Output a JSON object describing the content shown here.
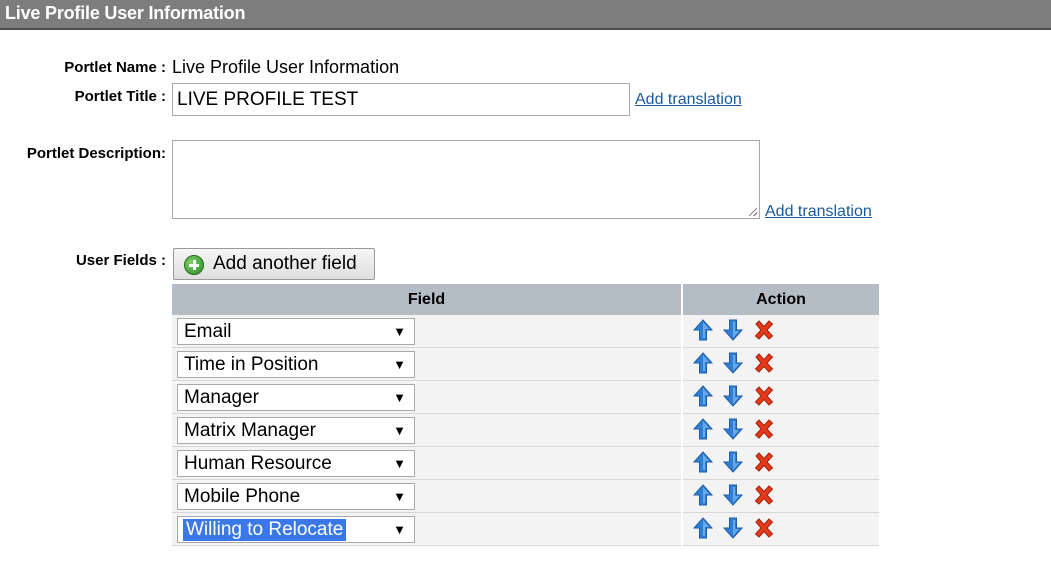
{
  "header": {
    "title": "Live Profile User Information"
  },
  "form": {
    "portlet_name_label": "Portlet Name :",
    "portlet_name_value": "Live Profile User Information",
    "portlet_title_label": "Portlet Title :",
    "portlet_title_value": "LIVE PROFILE TEST",
    "portlet_description_label": "Portlet Description:",
    "portlet_description_value": "",
    "add_translation": "Add translation",
    "user_fields_label": "User Fields :",
    "add_field_button": "Add another field"
  },
  "table": {
    "headers": {
      "field": "Field",
      "action": "Action"
    },
    "rows": [
      {
        "field": "Email",
        "selected": false
      },
      {
        "field": "Time in Position",
        "selected": false
      },
      {
        "field": "Manager",
        "selected": false
      },
      {
        "field": "Matrix Manager",
        "selected": false
      },
      {
        "field": "Human Resource",
        "selected": false
      },
      {
        "field": "Mobile Phone",
        "selected": false
      },
      {
        "field": "Willing to Relocate",
        "selected": true
      }
    ]
  },
  "icons": {
    "move_up": "arrow-up-icon",
    "move_down": "arrow-down-icon",
    "delete": "delete-icon",
    "add": "plus-circle-icon",
    "dropdown": "dropdown-arrow-icon"
  },
  "colors": {
    "header_bg": "#7d7d7d",
    "table_header_bg": "#b4bcc5",
    "link": "#1a5a9a",
    "arrow_blue": "#2f7fd6",
    "delete_red": "#e23a1a",
    "selection": "#3b78e7"
  }
}
